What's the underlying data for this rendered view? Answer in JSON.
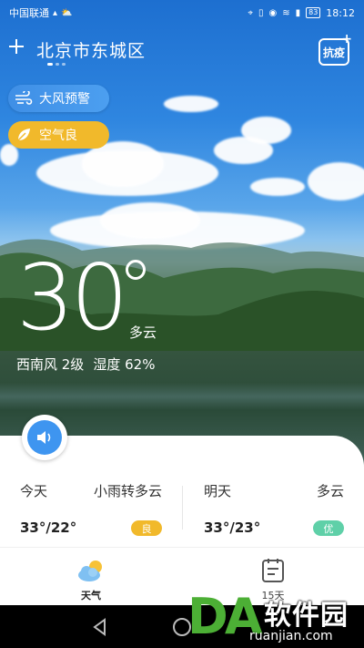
{
  "status_bar": {
    "carrier": "中国联通",
    "time": "18:12",
    "battery": "83"
  },
  "header": {
    "add_icon": "plus-icon",
    "city": "北京市东城区",
    "epidemic_label": "抗疫",
    "page_count": 3
  },
  "alerts": [
    {
      "label": "大风预警",
      "icon": "wind-icon",
      "color": "#3f8fe6"
    },
    {
      "label": "空气良",
      "icon": "leaf-icon",
      "color": "#f1b92b"
    }
  ],
  "current": {
    "temperature": "30",
    "condition": "多云",
    "wind": "西南风 2级",
    "humidity_label": "湿度",
    "humidity": "62%"
  },
  "forecast": [
    {
      "day": "今天",
      "condition": "小雨转多云",
      "range": "33°/22°",
      "aqi": "良",
      "aqi_color": "#f1b92b"
    },
    {
      "day": "明天",
      "condition": "多云",
      "range": "33°/23°",
      "aqi": "优",
      "aqi_color": "#5fd0a8"
    }
  ],
  "tabs": [
    {
      "label": "天气",
      "icon": "weather-cloud-sun-icon",
      "active": true
    },
    {
      "label": "15天",
      "icon": "calendar-icon",
      "active": false
    }
  ],
  "watermark": {
    "letters": "DA",
    "text": "软件园",
    "url": "ruanjian.com"
  }
}
